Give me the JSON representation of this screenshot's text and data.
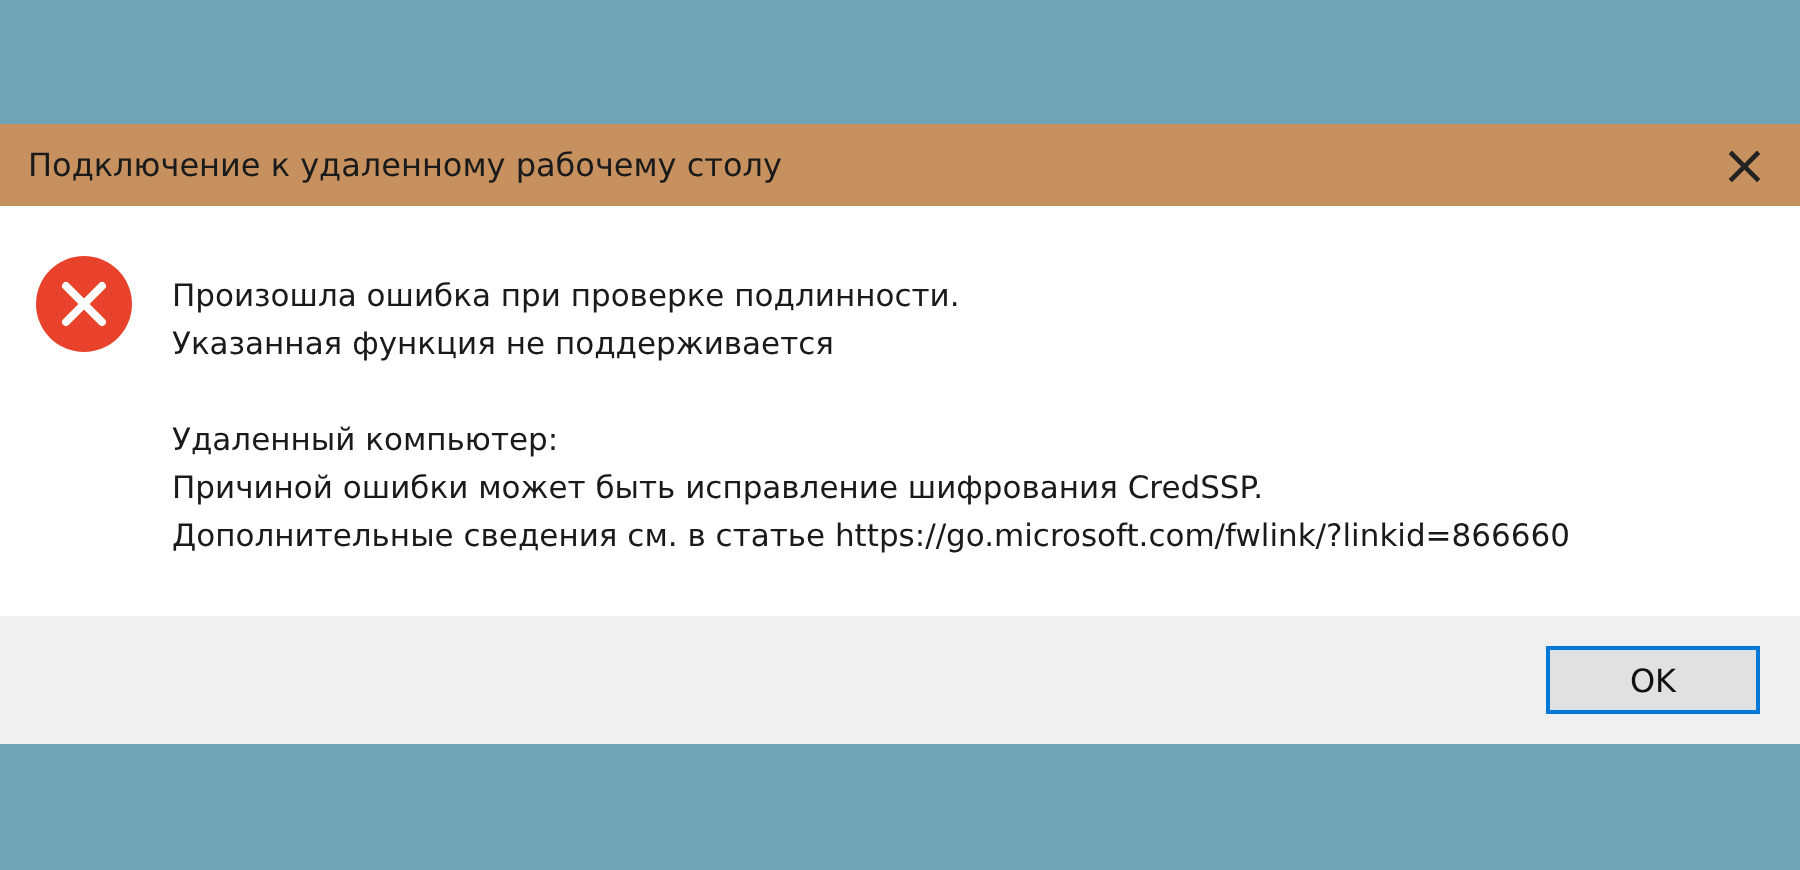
{
  "window": {
    "title": "Подключение к удаленному рабочему столу",
    "close": "×"
  },
  "message": {
    "lines": [
      "Произошла ошибка при проверке подлинности.",
      "Указанная функция не поддерживается"
    ],
    "details": [
      "Удаленный компьютер:",
      "Причиной ошибки может быть исправление шифрования CredSSP.",
      "Дополнительные сведения см. в статье https://go.microsoft.com/fwlink/?linkid=866660"
    ]
  },
  "buttons": [
    {
      "label": "OK",
      "selected": true
    }
  ]
}
